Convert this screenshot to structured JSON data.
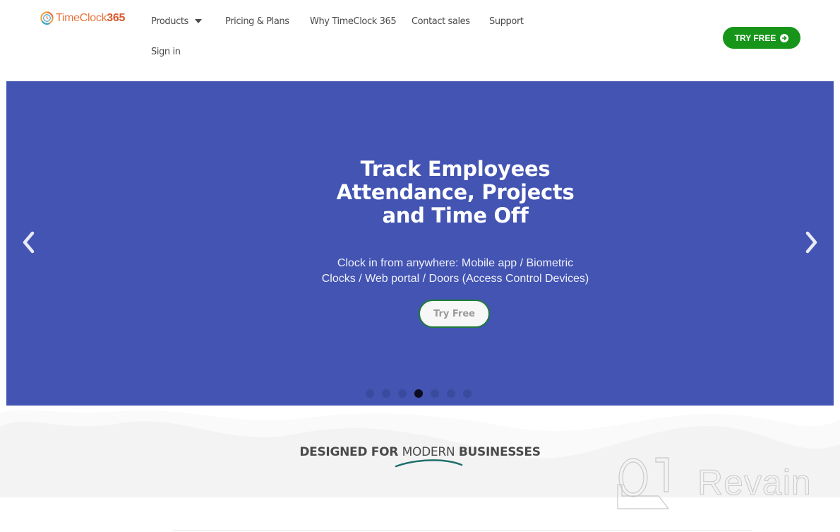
{
  "header": {
    "logo": {
      "text_main": "TimeClock",
      "text_number": "365",
      "icon": "clock-logo-icon"
    },
    "nav": [
      {
        "label": "Products",
        "has_dropdown": true
      },
      {
        "label": "Pricing & Plans"
      },
      {
        "label": "Why TimeClock 365"
      },
      {
        "label": "Contact sales"
      },
      {
        "label": "Support"
      },
      {
        "label": "Sign in"
      }
    ],
    "cta": {
      "label": "TRY FREE",
      "icon": "arrow-circle-right-icon",
      "color": "#17951a"
    }
  },
  "hero": {
    "background": "#4354b2",
    "title_lines": [
      "Track Employees",
      "Attendance, Projects",
      "and Time Off"
    ],
    "subtitle_lines": [
      "Clock in from anywhere: Mobile app / Biometric",
      "Clocks / Web portal / Doors (Access Control Devices)"
    ],
    "cta_label": "Try Free",
    "prev_icon": "chevron-left-icon",
    "next_icon": "chevron-right-icon",
    "slides_total": 7,
    "active_slide": 4
  },
  "section": {
    "title_bold_1": "DESIGNED FOR ",
    "title_light": "MODERN",
    "title_bold_2": " BUSINESSES",
    "accent_color": "#1f6f6a"
  },
  "watermark": {
    "text": "Revain"
  }
}
